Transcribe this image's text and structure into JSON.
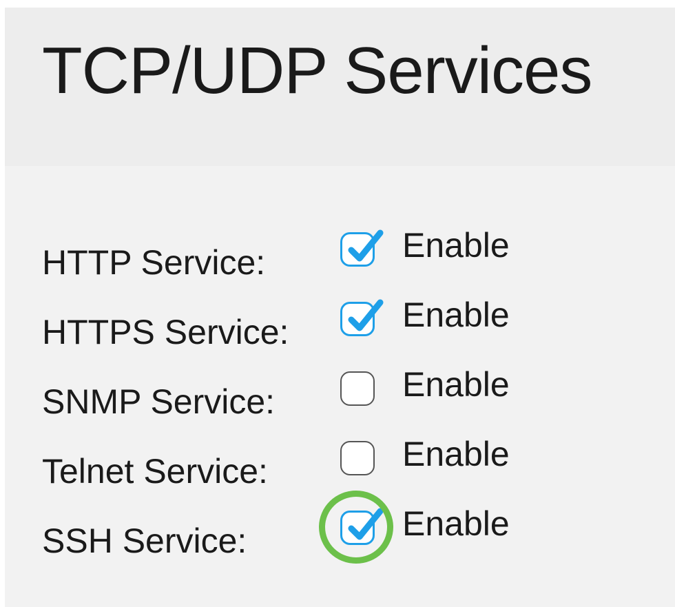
{
  "page": {
    "title": "TCP/UDP Services"
  },
  "colors": {
    "checkbox_checked": "#1e9fe8",
    "checkbox_unchecked_border": "#555555",
    "highlight_ring": "#6cc04a",
    "header_background": "#ededed",
    "page_background": "#f2f2f2"
  },
  "services": [
    {
      "label": "HTTP Service:",
      "enable_label": "Enable",
      "checked": true,
      "highlighted": false
    },
    {
      "label": "HTTPS Service:",
      "enable_label": "Enable",
      "checked": true,
      "highlighted": false
    },
    {
      "label": "SNMP Service:",
      "enable_label": "Enable",
      "checked": false,
      "highlighted": false
    },
    {
      "label": "Telnet Service:",
      "enable_label": "Enable",
      "checked": false,
      "highlighted": false
    },
    {
      "label": "SSH Service:",
      "enable_label": "Enable",
      "checked": true,
      "highlighted": true
    }
  ],
  "icons": {
    "check": "checkmark-icon"
  }
}
